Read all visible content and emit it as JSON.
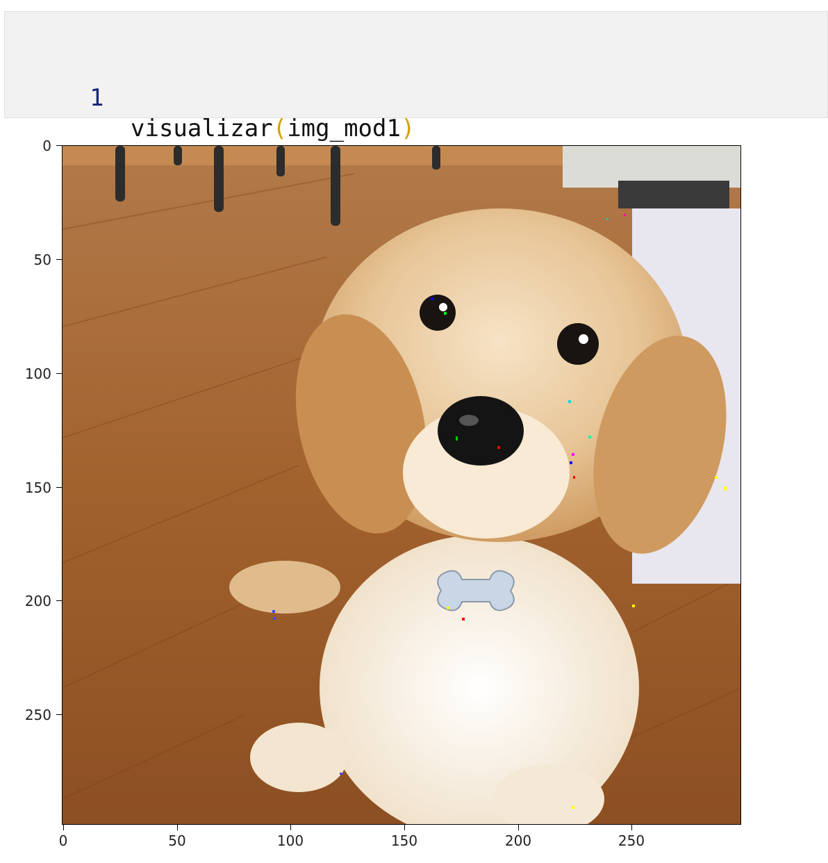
{
  "code_cell": {
    "line_number": "1",
    "function": "visualizar",
    "open_paren": "(",
    "argument": "img_mod1",
    "close_paren": ")"
  },
  "output": {
    "image_subject": "golden retriever puppy on wooden floor",
    "y_ticks": [
      "0",
      "50",
      "100",
      "150",
      "200",
      "250"
    ],
    "x_ticks": [
      "0",
      "50",
      "100",
      "150",
      "200",
      "250"
    ]
  },
  "colors": {
    "code_bg": "#f2f2f2",
    "line_number": "#1a237e",
    "paren": "#d4a000"
  }
}
